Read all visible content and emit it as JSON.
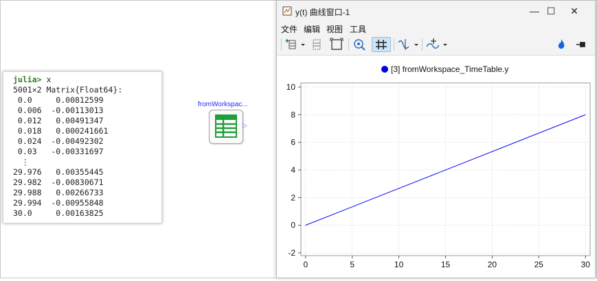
{
  "repl": {
    "prompt": "julia>",
    "command": "x",
    "type_line": "5001×2 Matrix{Float64}:",
    "rows_top": [
      " 0.0     0.00812599",
      " 0.006  -0.00113013",
      " 0.012   0.00491347",
      " 0.018   0.000241661",
      " 0.024  -0.00492302",
      " 0.03   -0.00331697"
    ],
    "vdots": "⋮",
    "rows_bottom": [
      "29.976   0.00355445",
      "29.982  -0.00830671",
      "29.988   0.00266733",
      "29.994  -0.00955848",
      "30.0     0.00163825"
    ]
  },
  "block": {
    "label": "fromWorkspac...",
    "port_glyph": "▷",
    "icon": "table-icon"
  },
  "window": {
    "title": "y(t) 曲线窗口-1",
    "controls": {
      "minimize": "—",
      "maximize": "☐",
      "close": "✕"
    },
    "menu": [
      "文件",
      "编辑",
      "视图",
      "工具"
    ],
    "toolbar_icons": [
      "insert-plot-icon",
      "dropdown-icon",
      "layout-icon",
      "fit-frame-icon",
      "zoom-icon",
      "grid-toggle-icon",
      "curve-style-icon",
      "dropdown-icon",
      "add-curve-icon",
      "dropdown-icon",
      "flame-icon",
      "pin-icon"
    ],
    "accent": "#0a62c9"
  },
  "chart_data": {
    "type": "line",
    "legend": {
      "label": "[3] fromWorkspace_TimeTable.y",
      "marker_color": "#0000dd",
      "placement": "top-center"
    },
    "series": [
      {
        "name": "[3] fromWorkspace_TimeTable.y",
        "color": "#0000ff",
        "x": [
          0,
          30
        ],
        "y": [
          0,
          8
        ]
      }
    ],
    "x_ticks": [
      0,
      5,
      10,
      15,
      20,
      25,
      30
    ],
    "y_ticks": [
      -2,
      0,
      2,
      4,
      6,
      8,
      10
    ],
    "xlim": [
      -0.5,
      30.5
    ],
    "ylim": [
      -2.2,
      10.3
    ],
    "grid": true,
    "xlabel": "",
    "ylabel": ""
  }
}
